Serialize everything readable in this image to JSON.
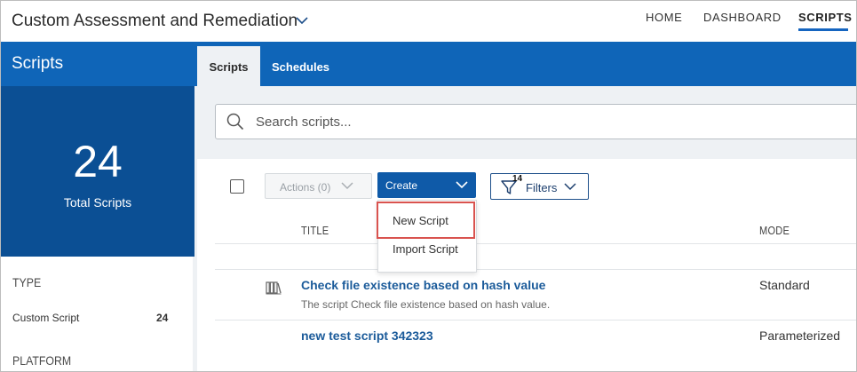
{
  "header": {
    "app_title": "Custom Assessment and Remediation",
    "nav": {
      "home": "HOME",
      "dashboard": "DASHBOARD",
      "scripts": "SCRIPTS"
    },
    "active_nav": "SCRIPTS"
  },
  "sidebar": {
    "title": "Scripts",
    "total": {
      "value": "24",
      "label": "Total Scripts"
    },
    "sections": [
      {
        "heading": "TYPE",
        "items": [
          {
            "label": "Custom Script",
            "count": "24"
          }
        ]
      },
      {
        "heading": "PLATFORM",
        "items": []
      }
    ]
  },
  "tabs": [
    {
      "label": "Scripts",
      "active": true
    },
    {
      "label": "Schedules",
      "active": false
    }
  ],
  "search": {
    "placeholder": "Search scripts...",
    "value": ""
  },
  "toolbar": {
    "actions_label": "Actions (0)",
    "create_label": "Create",
    "filters_label": "Filters",
    "filters_count": "14"
  },
  "create_menu": {
    "items": [
      "New Script",
      "Import Script"
    ],
    "highlighted": "New Script"
  },
  "table": {
    "columns": [
      "TITLE",
      "MODE"
    ],
    "rows": [
      {
        "title": "Check file existence based on hash value",
        "description": "The script Check file existence based on hash value.",
        "mode": "Standard"
      },
      {
        "title": "new test script 342323",
        "description": "",
        "mode": "Parameterized"
      }
    ]
  },
  "colors": {
    "primary": "#0f65b8",
    "stat_box": "#0b4f94",
    "link": "#1b5b9a",
    "highlight": "#d9534f"
  },
  "icons": [
    "chevron-down-icon",
    "search-icon",
    "funnel-icon",
    "library-books-icon"
  ]
}
